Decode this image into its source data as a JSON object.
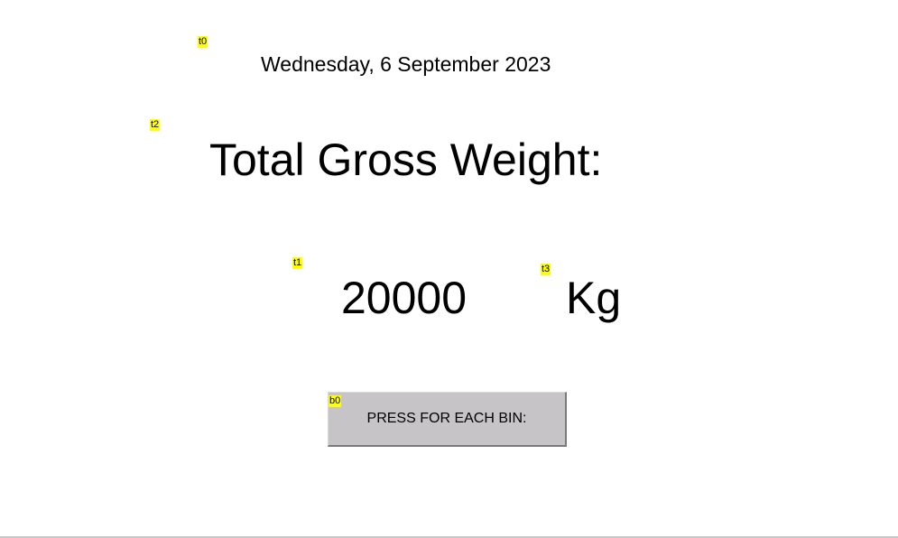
{
  "tags": {
    "t0": "t0",
    "t1": "t1",
    "t2": "t2",
    "t3": "t3",
    "b0": "b0"
  },
  "header": {
    "date": "Wednesday, 6 September 2023"
  },
  "main": {
    "title": "Total Gross Weight:",
    "weight_value": "20000",
    "weight_unit": "Kg",
    "button_label": "PRESS FOR EACH BIN:"
  },
  "colors": {
    "tag_background": "#ffff00",
    "button_face": "#c6c4c6"
  }
}
